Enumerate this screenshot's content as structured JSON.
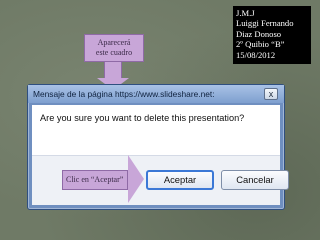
{
  "credits": {
    "lines": [
      "J.M.J",
      "Luiggi Fernando",
      "Diaz Donoso",
      "2º Quibio “B”",
      "15/08/2012"
    ]
  },
  "callouts": {
    "top": {
      "line1": "Aparecerá",
      "line2": "este cuadro"
    },
    "left": {
      "text": "Clic en “Aceptar”"
    }
  },
  "dialog": {
    "title": "Mensaje de la página https://www.slideshare.net:",
    "close_label": "x",
    "message": "Are you sure you want to delete this presentation?",
    "accept_label": "Aceptar",
    "cancel_label": "Cancelar"
  }
}
